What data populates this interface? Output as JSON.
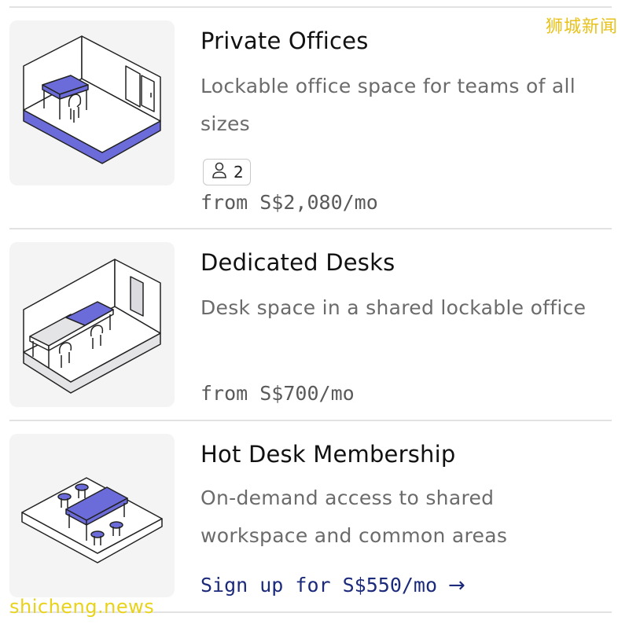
{
  "watermark": {
    "cn": "狮城新闻",
    "site": "shicheng.news"
  },
  "cards": [
    {
      "title": "Private Offices",
      "description": "Lockable office space for teams of all sizes",
      "capacity": "2",
      "capacity_icon": "person-icon",
      "price": "from S$2,080/mo",
      "illustration": "private-office-illustration"
    },
    {
      "title": "Dedicated Desks",
      "description": "Desk space in a shared lockable office",
      "price": "from S$700/mo",
      "illustration": "dedicated-desk-illustration"
    },
    {
      "title": "Hot Desk Membership",
      "description": "On-demand access to shared workspace and common areas",
      "cta": "Sign up for S$550/mo",
      "cta_icon": "arrow-right-icon",
      "illustration": "hot-desk-illustration"
    }
  ],
  "colors": {
    "accent": "#6b6bd9",
    "cta": "#1b2a7a",
    "muted": "#6b6b6b"
  }
}
